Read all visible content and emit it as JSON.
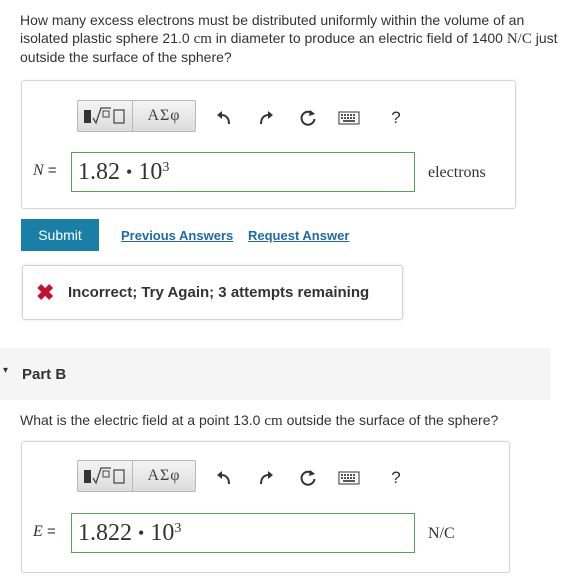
{
  "part_a": {
    "question_pre": "How many excess electrons must be distributed uniformly within the volume of an isolated plastic sphere 21.0 ",
    "question_unit1": "cm",
    "question_mid": " in diameter to produce an electric field of 1400 ",
    "question_unit2": "N/C",
    "question_post": " just outside the surface of the sphere?",
    "toolbar": {
      "template_label": "√",
      "greek_label": "ΑΣφ",
      "undo_icon": "undo-arrow",
      "redo_icon": "redo-arrow",
      "reset_icon": "reset-circular-arrow",
      "keyboard_icon": "keyboard",
      "help_label": "?"
    },
    "variable": "N",
    "equals": "=",
    "answer_mantissa": "1.82",
    "answer_dot": "•",
    "answer_base": "10",
    "answer_exponent": "3",
    "unit": "electrons",
    "submit_label": "Submit",
    "previous_answers_label": "Previous Answers",
    "request_answer_label": "Request Answer",
    "feedback": "Incorrect; Try Again; 3 attempts remaining"
  },
  "part_b": {
    "header": "Part B",
    "question_pre": "What is the electric field at a point 13.0 ",
    "question_unit": "cm",
    "question_post": " outside the surface of the sphere?",
    "toolbar": {
      "template_label": "√",
      "greek_label": "ΑΣφ",
      "help_label": "?"
    },
    "variable": "E",
    "equals": "=",
    "answer_mantissa": "1.822",
    "answer_dot": "•",
    "answer_base": "10",
    "answer_exponent": "3",
    "unit": "N/C"
  },
  "colors": {
    "submit_bg": "#1a7fa6",
    "link": "#1f6aa8",
    "error_x": "#c8102e",
    "input_border": "#5a9e5a"
  }
}
